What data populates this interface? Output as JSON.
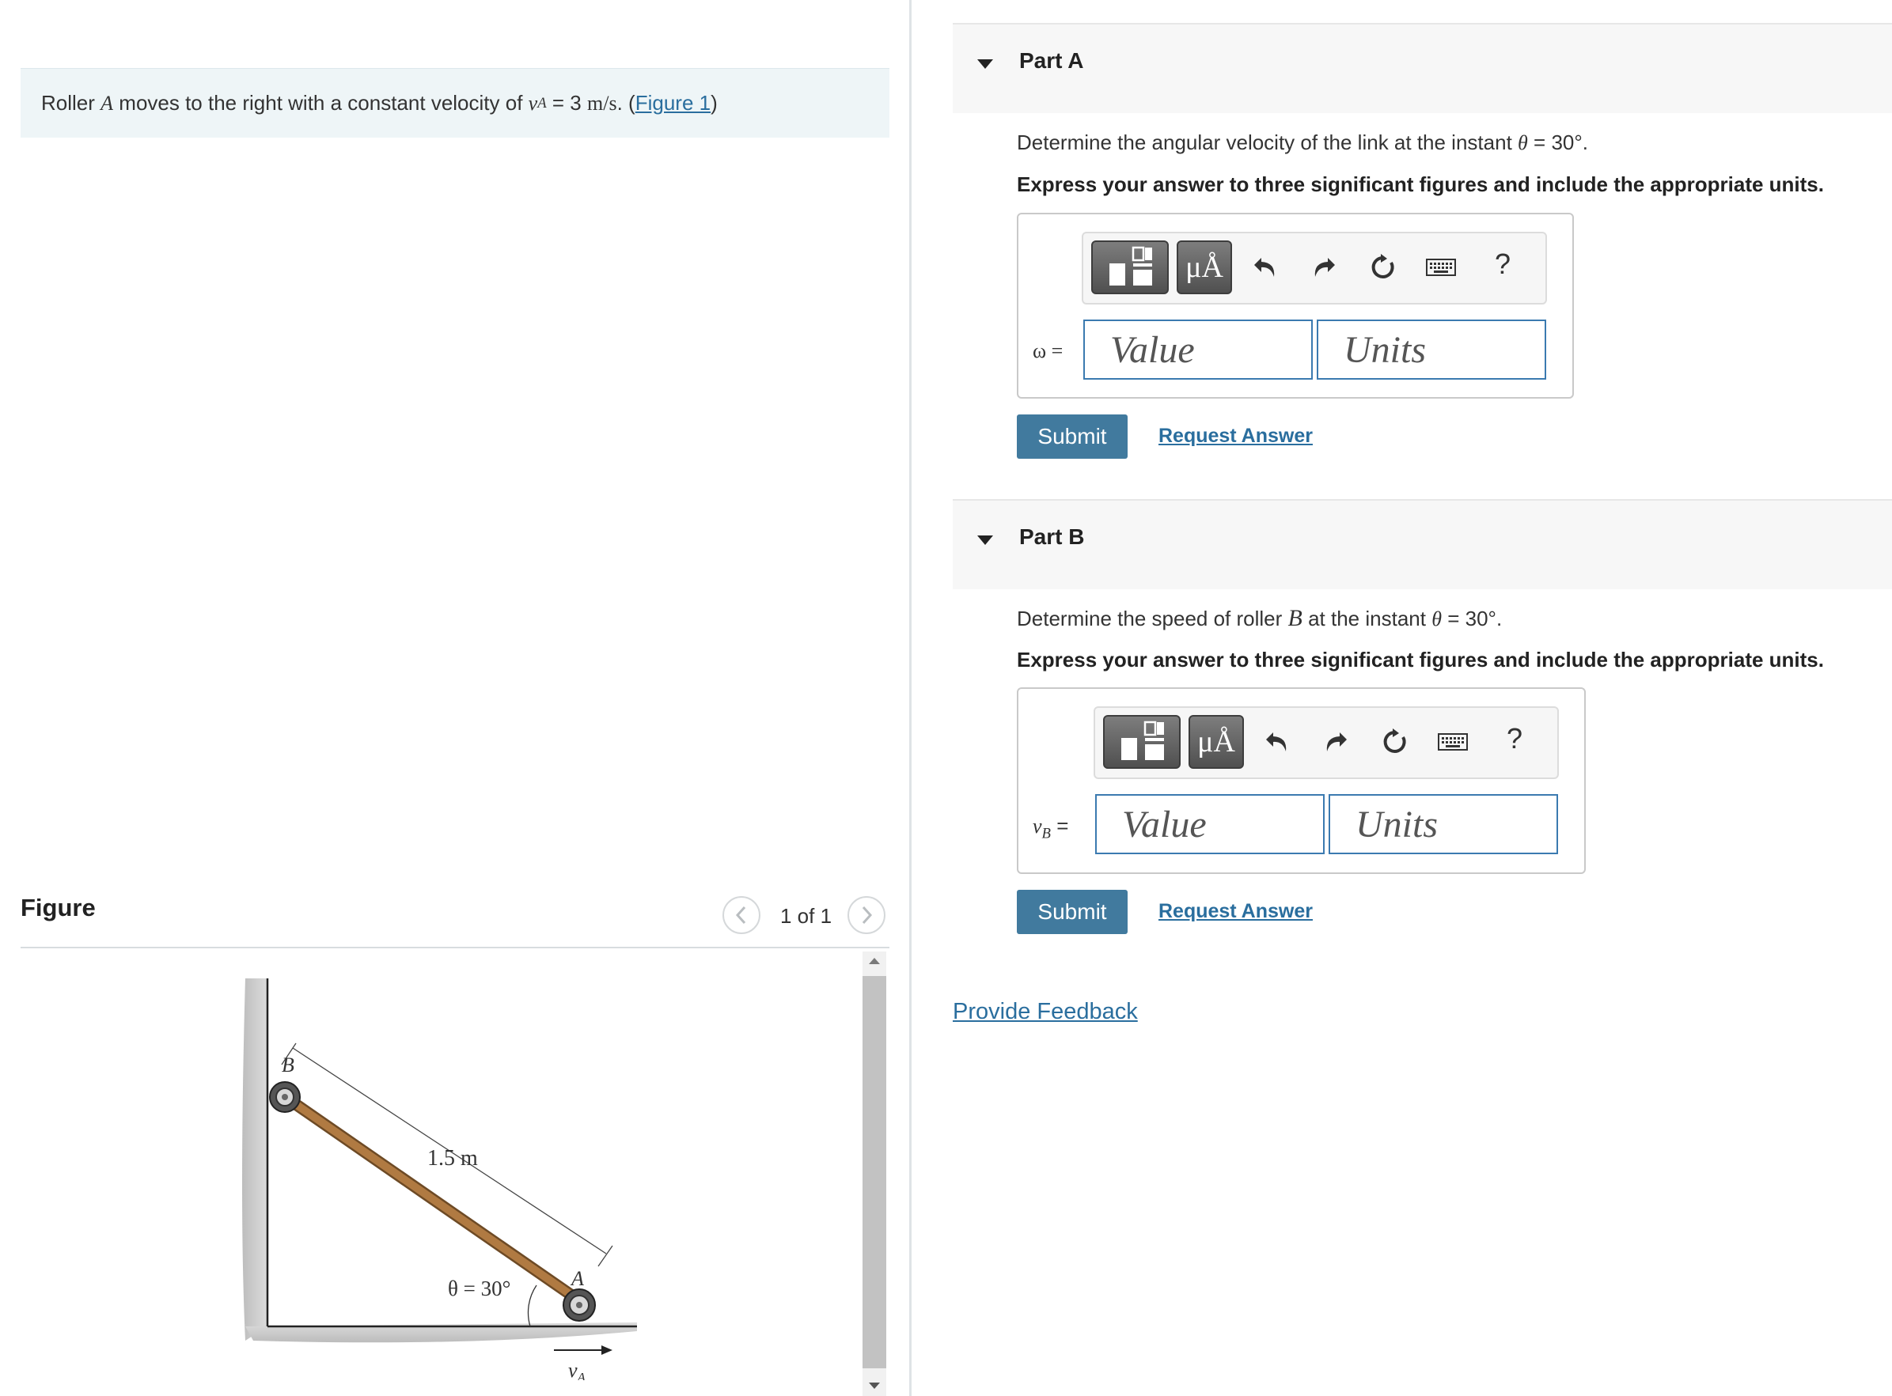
{
  "intro": {
    "text_before": "Roller",
    "roller_symbol": "A",
    "text_middle": "moves to the right with a constant velocity of",
    "velocity_symbol": "v",
    "velocity_subscript": "A",
    "equals": "=",
    "velocity_value": "3",
    "velocity_unit": "m/s",
    "period": ".",
    "open_paren": "(",
    "figure_link": "Figure 1",
    "close_paren": ")"
  },
  "figure": {
    "title": "Figure",
    "pager_text": "1 of 1",
    "labels": {
      "point_b": "B",
      "point_a": "A",
      "length": "1.5 m",
      "angle": "θ = 30°",
      "velocity_symbol": "v",
      "velocity_subscript": "A"
    }
  },
  "partA": {
    "title": "Part A",
    "question_before": "Determine the angular velocity of the link at the instant",
    "theta": "θ",
    "angle_text": "= 30°",
    "question_after": ".",
    "instruction": "Express your answer to three significant figures and include the appropriate units.",
    "answer_label": "ω =",
    "value_placeholder": "Value",
    "units_placeholder": "Units",
    "submit": "Submit",
    "request_answer": "Request Answer",
    "help": "?"
  },
  "partB": {
    "title": "Part B",
    "question_before": "Determine the speed of roller",
    "roller_symbol": "B",
    "question_middle": "at the instant",
    "theta": "θ",
    "angle_text": "= 30°",
    "question_after": ".",
    "instruction": "Express your answer to three significant figures and include the appropriate units.",
    "answer_symbol": "v",
    "answer_subscript": "B",
    "answer_equals": "=",
    "value_placeholder": "Value",
    "units_placeholder": "Units",
    "submit": "Submit",
    "request_answer": "Request Answer",
    "help": "?"
  },
  "feedback": {
    "label": "Provide Feedback"
  },
  "icons": [
    "templates-icon",
    "units-icon",
    "undo-icon",
    "redo-icon",
    "reset-icon",
    "keyboard-icon",
    "help-icon",
    "caret-down-icon",
    "chevron-left-icon",
    "chevron-right-icon"
  ],
  "colors": {
    "link": "#2a6e9e",
    "submit": "#417a9e",
    "input_border": "#3b7ab0",
    "intro_bg": "#eef5f7",
    "rod": "#a8753f"
  }
}
